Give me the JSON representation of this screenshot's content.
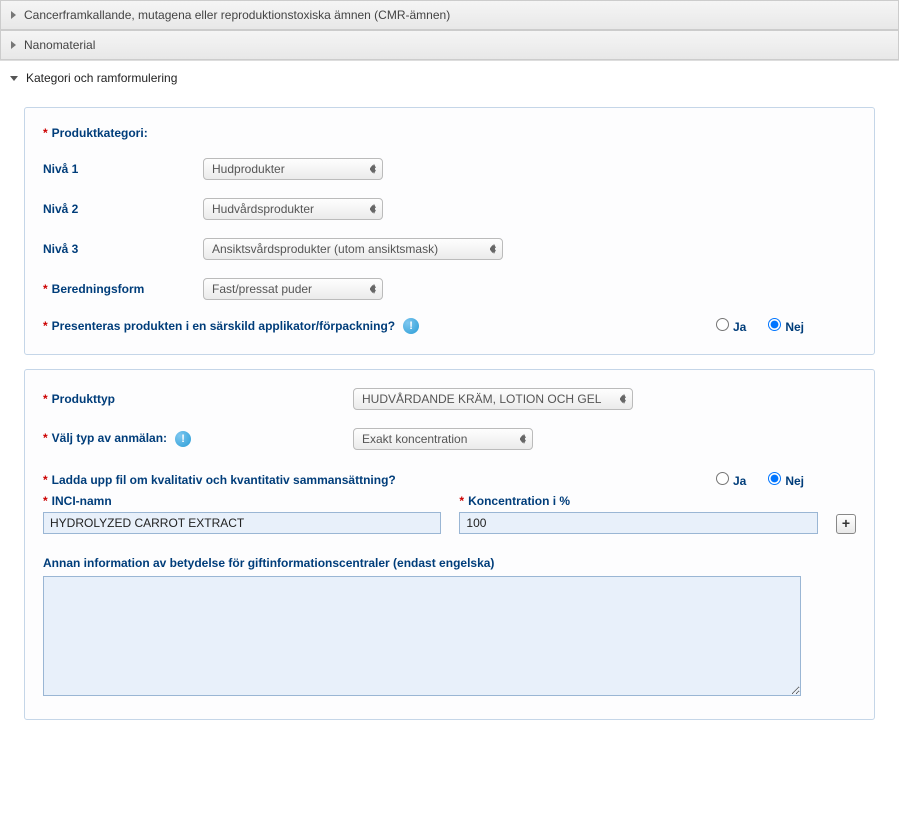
{
  "accordion": {
    "cmr": "Cancerframkallande, mutagena eller reproduktionstoxiska ämnen (CMR-ämnen)",
    "nano": "Nanomaterial",
    "kategori": "Kategori och ramformulering"
  },
  "panel1": {
    "produktkategori_label": "Produktkategori:",
    "niva1_label": "Nivå 1",
    "niva1_value": "Hudprodukter",
    "niva2_label": "Nivå 2",
    "niva2_value": "Hudvårdsprodukter",
    "niva3_label": "Nivå 3",
    "niva3_value": "Ansiktsvårdsprodukter (utom ansiktsmask)",
    "beredningsform_label": "Beredningsform",
    "beredningsform_value": "Fast/pressat puder",
    "applikator_q": "Presenteras produkten i en särskild applikator/förpackning?",
    "ja": "Ja",
    "nej": "Nej"
  },
  "panel2": {
    "produkttyp_label": "Produkttyp",
    "produkttyp_value": "HUDVÅRDANDE KRÄM, LOTION OCH GEL",
    "anmalan_label": "Välj typ av anmälan:",
    "anmalan_value": "Exakt koncentration",
    "ladda_q": "Ladda upp fil om kvalitativ och kvantitativ sammansättning?",
    "ja": "Ja",
    "nej": "Nej",
    "inci_label": "INCI-namn",
    "inci_value": "HYDROLYZED CARROT EXTRACT",
    "konc_label": "Koncentration i %",
    "konc_value": "100",
    "annan_label": "Annan information av betydelse för giftinformationscentraler (endast engelska)"
  }
}
